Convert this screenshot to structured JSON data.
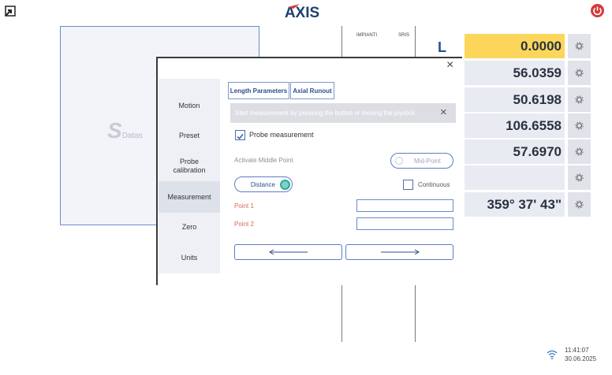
{
  "app": {
    "brand": "AXIS"
  },
  "viewport": {
    "watermark": "Datas",
    "scale_label_a": "IMPIANTI",
    "scale_label_b": "SRIS"
  },
  "axis": {
    "letter": "L"
  },
  "readouts": [
    {
      "value": "0.0000",
      "highlighted": true
    },
    {
      "value": "56.0359",
      "highlighted": false
    },
    {
      "value": "50.6198",
      "highlighted": false
    },
    {
      "value": "106.6558",
      "highlighted": false
    },
    {
      "value": "57.6970",
      "highlighted": false
    },
    {
      "value": "",
      "highlighted": false
    },
    {
      "value": "359° 37' 43\"",
      "highlighted": false
    }
  ],
  "dialog": {
    "close_glyph": "×",
    "menu": [
      {
        "label": "Motion"
      },
      {
        "label": "Preset"
      },
      {
        "label": "Probe calibration"
      },
      {
        "label": "Measurement",
        "active": true
      },
      {
        "label": "Zero"
      },
      {
        "label": "Units"
      }
    ],
    "tabs": [
      {
        "label": "Length Parameters",
        "active": true
      },
      {
        "label": "Axial Runout"
      }
    ],
    "info": {
      "message": "Start measurement by pressing the button or moving the joystick.",
      "close_glyph": "×"
    },
    "probe_measurement": {
      "label": "Probe measurement",
      "checked": true
    },
    "middle_point": {
      "label": "Activate Middle Point",
      "toggle_label": "Mid-Point",
      "on": false
    },
    "distance": {
      "toggle_label": "Distance",
      "on": true
    },
    "continuous": {
      "label": "Continuous",
      "checked": false
    },
    "points": [
      {
        "label": "Point 1",
        "value": ""
      },
      {
        "label": "Point 2",
        "value": ""
      }
    ],
    "buttons": {
      "prev": "prev-arrow",
      "next": "next-arrow"
    }
  },
  "status": {
    "time": "11:41:07",
    "date": "30.06.2025"
  },
  "colors": {
    "accent": "#2c4f8e",
    "highlight": "#fbd65a",
    "power": "#d43b3b"
  }
}
